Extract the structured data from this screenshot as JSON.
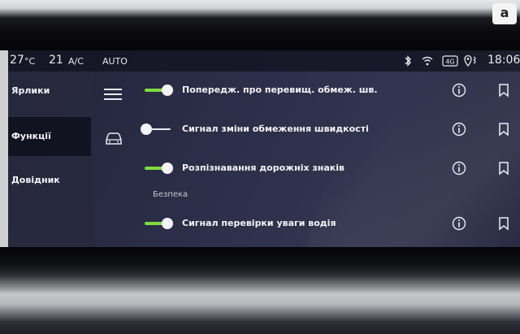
{
  "status": {
    "temp_left": "27",
    "temp_left_unit": "°C",
    "temp_right": "21",
    "ac_label": "A/C",
    "auto_label": "AUTO",
    "clock": "18:06"
  },
  "sidebar": {
    "items": [
      {
        "label": "Ярлики",
        "active": false
      },
      {
        "label": "Функції",
        "active": true
      },
      {
        "label": "Довідник",
        "active": false
      }
    ]
  },
  "settings": {
    "rows": [
      {
        "label": "Попередж. про перевищ. обмеж. шв.",
        "on": true
      },
      {
        "label": "Сигнал зміни обмеження швидкості",
        "on": false
      },
      {
        "label": "Розпізнавання дорожніх знаків",
        "on": true
      },
      {
        "label": "Сигнал перевірки уваги водія",
        "on": true
      }
    ],
    "section_label": "Безпека"
  },
  "colors": {
    "toggle_on": "#7fdc3a",
    "toggle_off": "#e9e9ef",
    "screen_bg": "#2c2f49"
  },
  "watermark": "a"
}
